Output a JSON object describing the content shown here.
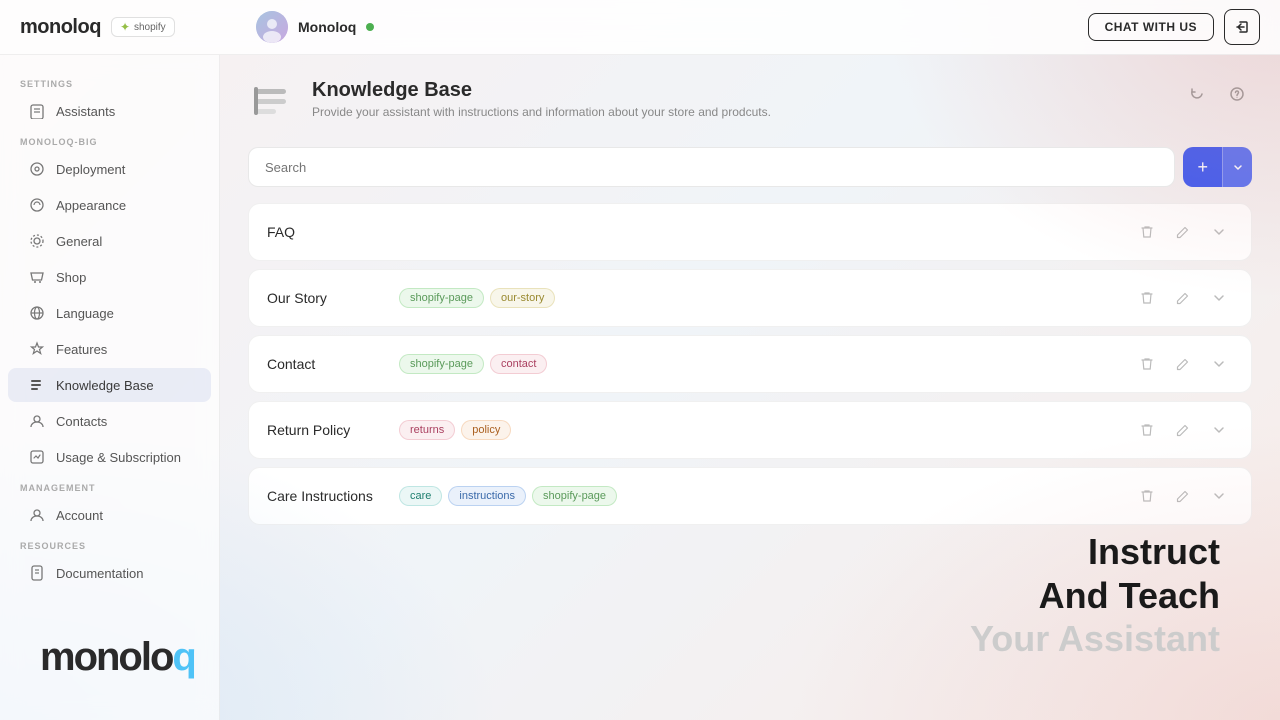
{
  "topbar": {
    "logo": "monoloq",
    "shopify_label": "shopify",
    "user_name": "Monoloq",
    "chat_btn_label": "CHAT WITH US",
    "online_status": "online"
  },
  "sidebar": {
    "sections": [
      {
        "label": "SETTINGS",
        "items": [
          {
            "id": "assistants",
            "label": "Assistants",
            "icon": "file-icon"
          }
        ]
      },
      {
        "label": "MONOLOQ-BIG",
        "items": [
          {
            "id": "deployment",
            "label": "Deployment",
            "icon": "deployment-icon"
          },
          {
            "id": "appearance",
            "label": "Appearance",
            "icon": "appearance-icon"
          },
          {
            "id": "general",
            "label": "General",
            "icon": "general-icon"
          },
          {
            "id": "shop",
            "label": "Shop",
            "icon": "shop-icon"
          },
          {
            "id": "language",
            "label": "Language",
            "icon": "language-icon"
          },
          {
            "id": "features",
            "label": "Features",
            "icon": "features-icon"
          },
          {
            "id": "knowledge-base",
            "label": "Knowledge Base",
            "icon": "knowledge-icon",
            "active": true
          },
          {
            "id": "contacts",
            "label": "Contacts",
            "icon": "contacts-icon"
          },
          {
            "id": "usage-subscription",
            "label": "Usage & Subscription",
            "icon": "usage-icon"
          }
        ]
      },
      {
        "label": "MANAGEMENT",
        "items": [
          {
            "id": "account",
            "label": "Account",
            "icon": "account-icon"
          }
        ]
      },
      {
        "label": "RESOURCES",
        "items": [
          {
            "id": "documentation",
            "label": "Documentation",
            "icon": "doc-icon"
          }
        ]
      }
    ]
  },
  "main": {
    "page_title": "Knowledge Base",
    "page_subtitle": "Provide your assistant with instructions and information about your store and prodcuts.",
    "search_placeholder": "Search",
    "add_btn_label": "+",
    "items": [
      {
        "id": "faq",
        "name": "FAQ",
        "tags": []
      },
      {
        "id": "our-story",
        "name": "Our Story",
        "tags": [
          {
            "label": "shopify-page",
            "style": "green"
          },
          {
            "label": "our-story",
            "style": "yellow"
          }
        ]
      },
      {
        "id": "contact",
        "name": "Contact",
        "tags": [
          {
            "label": "shopify-page",
            "style": "green"
          },
          {
            "label": "contact",
            "style": "pink"
          }
        ]
      },
      {
        "id": "return-policy",
        "name": "Return Policy",
        "tags": [
          {
            "label": "returns",
            "style": "pink"
          },
          {
            "label": "policy",
            "style": "orange"
          }
        ]
      },
      {
        "id": "care-instructions",
        "name": "Care Instructions",
        "tags": [
          {
            "label": "care",
            "style": "teal"
          },
          {
            "label": "instructions",
            "style": "blue"
          },
          {
            "label": "shopify-page",
            "style": "green"
          }
        ]
      }
    ]
  },
  "branding": {
    "bottom_logo": "monoloq",
    "tagline_line1": "Instruct",
    "tagline_line2": "And Teach",
    "tagline_line3": "Your Assistant"
  }
}
